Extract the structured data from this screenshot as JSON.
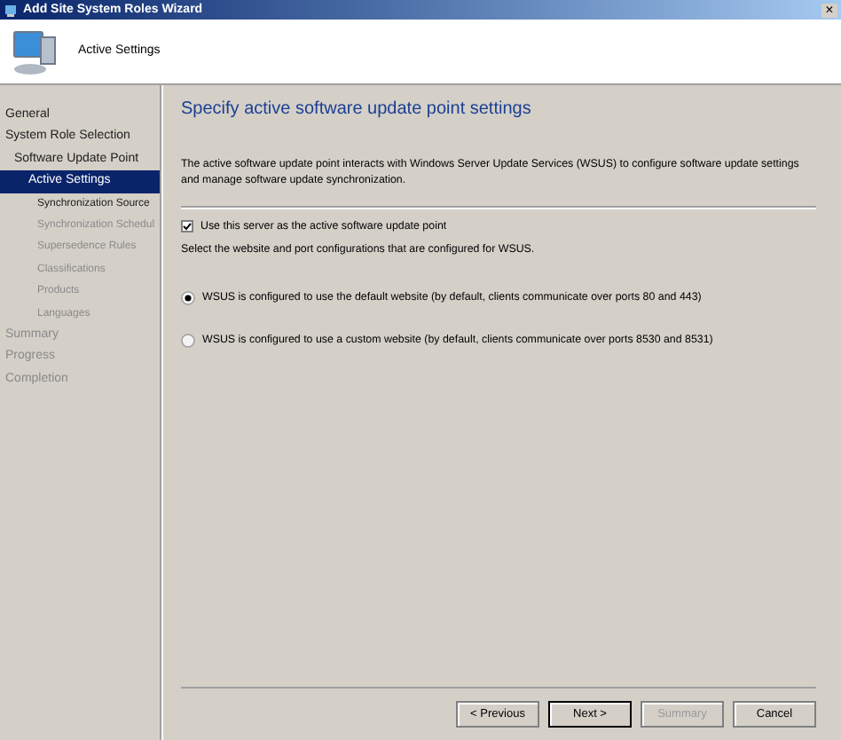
{
  "window": {
    "title": "Add Site System Roles Wizard",
    "close": "×"
  },
  "header": {
    "title": "Active Settings"
  },
  "sidebar": {
    "items": [
      {
        "label": "General",
        "selected": false,
        "disabled": false
      },
      {
        "label": "System Role Selection",
        "selected": false,
        "disabled": false,
        "children": [
          {
            "label": "Software Update Point",
            "selected": false,
            "disabled": false,
            "children": [
              {
                "label": "Active Settings",
                "selected": true,
                "disabled": false,
                "children": [
                  {
                    "label": "Synchronization Source",
                    "selected": false,
                    "disabled": false
                  },
                  {
                    "label": "Synchronization Schedul",
                    "selected": false,
                    "disabled": true
                  },
                  {
                    "label": "Supersedence Rules",
                    "selected": false,
                    "disabled": true
                  },
                  {
                    "label": "Classifications",
                    "selected": false,
                    "disabled": true
                  },
                  {
                    "label": "Products",
                    "selected": false,
                    "disabled": true
                  },
                  {
                    "label": "Languages",
                    "selected": false,
                    "disabled": true
                  }
                ]
              }
            ]
          }
        ]
      },
      {
        "label": "Summary",
        "selected": false,
        "disabled": true
      },
      {
        "label": "Progress",
        "selected": false,
        "disabled": true
      },
      {
        "label": "Completion",
        "selected": false,
        "disabled": true
      }
    ]
  },
  "content": {
    "heading": "Specify active software update point settings",
    "description": "The active software update point interacts with Windows Server Update Services (WSUS) to configure software update settings and manage software update synchronization.",
    "checkbox": {
      "label": "Use this server as the active software update point",
      "checked": true
    },
    "instruction": "Select the website and port configurations that are configured for WSUS.",
    "options": [
      {
        "label": "WSUS is configured to use the default website (by default, clients communicate over ports 80 and 443)",
        "selected": true
      },
      {
        "label": "WSUS is configured to use a custom website (by default, clients communicate over ports 8530 and 8531)",
        "selected": false
      }
    ]
  },
  "buttons": [
    {
      "label": "< Previous",
      "disabled": false,
      "default": false
    },
    {
      "label": "Next >",
      "disabled": false,
      "default": true
    },
    {
      "label": "Summary",
      "disabled": true,
      "default": false
    },
    {
      "label": "Cancel",
      "disabled": false,
      "default": false
    }
  ]
}
